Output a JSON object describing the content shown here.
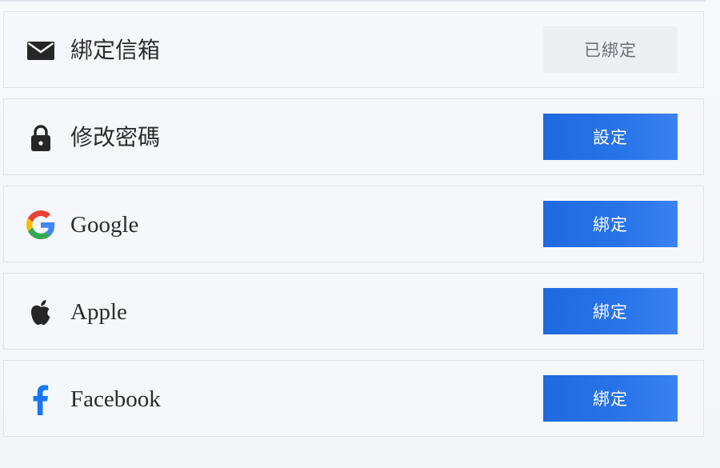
{
  "rows": [
    {
      "id": "email",
      "icon": "mail-icon",
      "label": "綁定信箱",
      "button": "已綁定",
      "state": "bound"
    },
    {
      "id": "password",
      "icon": "lock-icon",
      "label": "修改密碼",
      "button": "設定",
      "state": "action"
    },
    {
      "id": "google",
      "icon": "google-icon",
      "label": "Google",
      "button": "綁定",
      "state": "action"
    },
    {
      "id": "apple",
      "icon": "apple-icon",
      "label": "Apple",
      "button": "綁定",
      "state": "action"
    },
    {
      "id": "facebook",
      "icon": "facebook-icon",
      "label": "Facebook",
      "button": "綁定",
      "state": "action"
    }
  ],
  "colors": {
    "primary": "#2a74ea",
    "bound_bg": "#eceef2",
    "bound_text": "#6b6e75",
    "facebook": "#1877f2"
  }
}
